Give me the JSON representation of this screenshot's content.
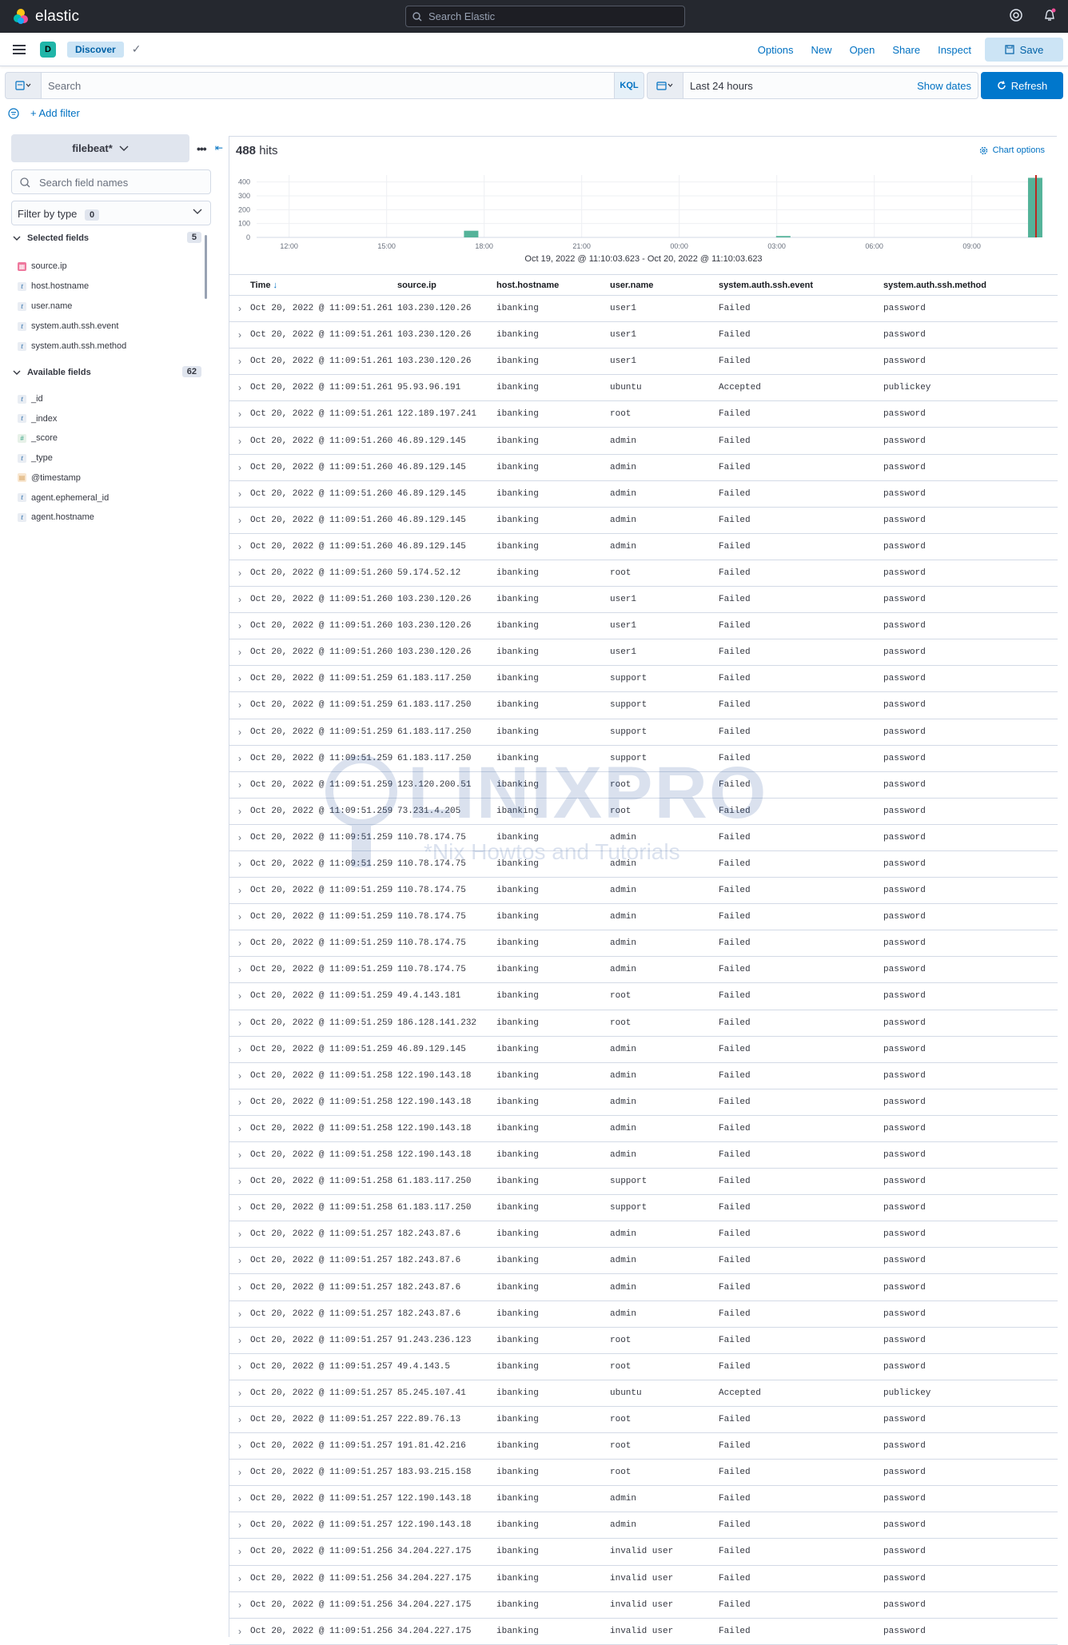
{
  "app": {
    "name": "elastic",
    "global_search_placeholder": "Search Elastic"
  },
  "nav": {
    "space_initial": "D",
    "breadcrumb": "Discover",
    "links": [
      "Options",
      "New",
      "Open",
      "Share",
      "Inspect"
    ],
    "save_label": "Save"
  },
  "query": {
    "search_placeholder": "Search",
    "language": "KQL",
    "time_range": "Last 24 hours",
    "show_dates": "Show dates",
    "refresh_label": "Refresh"
  },
  "filters": {
    "add_filter": "+ Add filter"
  },
  "sidebar": {
    "index_pattern": "filebeat*",
    "search_placeholder": "Search field names",
    "filter_by_type": "Filter by type",
    "filter_by_type_count": "0",
    "selected_title": "Selected fields",
    "selected_count": "5",
    "selected_fields": [
      {
        "name": "source.ip",
        "type": "ip"
      },
      {
        "name": "host.hostname",
        "type": "string"
      },
      {
        "name": "user.name",
        "type": "string"
      },
      {
        "name": "system.auth.ssh.event",
        "type": "string"
      },
      {
        "name": "system.auth.ssh.method",
        "type": "string"
      }
    ],
    "available_title": "Available fields",
    "available_count": "62",
    "available_fields": [
      {
        "name": "_id",
        "type": "string"
      },
      {
        "name": "_index",
        "type": "string"
      },
      {
        "name": "_score",
        "type": "number"
      },
      {
        "name": "_type",
        "type": "string"
      },
      {
        "name": "@timestamp",
        "type": "date"
      },
      {
        "name": "agent.ephemeral_id",
        "type": "string"
      },
      {
        "name": "agent.hostname",
        "type": "string"
      }
    ]
  },
  "main": {
    "hits_count": "488",
    "hits_label": "hits",
    "chart_options": "Chart options",
    "range_label": "Oct 19, 2022 @ 11:10:03.623 - Oct 20, 2022 @ 11:10:03.623"
  },
  "chart_data": {
    "type": "bar",
    "xlabel": "",
    "ylabel": "",
    "ylim": [
      0,
      450
    ],
    "yticks": [
      0,
      100,
      200,
      300,
      400
    ],
    "xticks": [
      "12:00",
      "15:00",
      "18:00",
      "21:00",
      "00:00",
      "03:00",
      "06:00",
      "09:00"
    ],
    "bar_color": "#54b399",
    "marker_color": "#bd271e",
    "grid": true,
    "values_note": "",
    "bars": [
      {
        "hour": 17.6,
        "value": 48
      },
      {
        "hour": 27.2,
        "value": 10
      },
      {
        "hour": 34.95,
        "value": 430
      }
    ]
  },
  "table": {
    "columns": [
      "Time",
      "source.ip",
      "host.hostname",
      "user.name",
      "system.auth.ssh.event",
      "system.auth.ssh.method"
    ],
    "rows": [
      [
        "Oct 20, 2022 @ 11:09:51.261",
        "103.230.120.26",
        "ibanking",
        "user1",
        "Failed",
        "password"
      ],
      [
        "Oct 20, 2022 @ 11:09:51.261",
        "103.230.120.26",
        "ibanking",
        "user1",
        "Failed",
        "password"
      ],
      [
        "Oct 20, 2022 @ 11:09:51.261",
        "103.230.120.26",
        "ibanking",
        "user1",
        "Failed",
        "password"
      ],
      [
        "Oct 20, 2022 @ 11:09:51.261",
        "95.93.96.191",
        "ibanking",
        "ubuntu",
        "Accepted",
        "publickey"
      ],
      [
        "Oct 20, 2022 @ 11:09:51.261",
        "122.189.197.241",
        "ibanking",
        "root",
        "Failed",
        "password"
      ],
      [
        "Oct 20, 2022 @ 11:09:51.260",
        "46.89.129.145",
        "ibanking",
        "admin",
        "Failed",
        "password"
      ],
      [
        "Oct 20, 2022 @ 11:09:51.260",
        "46.89.129.145",
        "ibanking",
        "admin",
        "Failed",
        "password"
      ],
      [
        "Oct 20, 2022 @ 11:09:51.260",
        "46.89.129.145",
        "ibanking",
        "admin",
        "Failed",
        "password"
      ],
      [
        "Oct 20, 2022 @ 11:09:51.260",
        "46.89.129.145",
        "ibanking",
        "admin",
        "Failed",
        "password"
      ],
      [
        "Oct 20, 2022 @ 11:09:51.260",
        "46.89.129.145",
        "ibanking",
        "admin",
        "Failed",
        "password"
      ],
      [
        "Oct 20, 2022 @ 11:09:51.260",
        "59.174.52.12",
        "ibanking",
        "root",
        "Failed",
        "password"
      ],
      [
        "Oct 20, 2022 @ 11:09:51.260",
        "103.230.120.26",
        "ibanking",
        "user1",
        "Failed",
        "password"
      ],
      [
        "Oct 20, 2022 @ 11:09:51.260",
        "103.230.120.26",
        "ibanking",
        "user1",
        "Failed",
        "password"
      ],
      [
        "Oct 20, 2022 @ 11:09:51.260",
        "103.230.120.26",
        "ibanking",
        "user1",
        "Failed",
        "password"
      ],
      [
        "Oct 20, 2022 @ 11:09:51.259",
        "61.183.117.250",
        "ibanking",
        "support",
        "Failed",
        "password"
      ],
      [
        "Oct 20, 2022 @ 11:09:51.259",
        "61.183.117.250",
        "ibanking",
        "support",
        "Failed",
        "password"
      ],
      [
        "Oct 20, 2022 @ 11:09:51.259",
        "61.183.117.250",
        "ibanking",
        "support",
        "Failed",
        "password"
      ],
      [
        "Oct 20, 2022 @ 11:09:51.259",
        "61.183.117.250",
        "ibanking",
        "support",
        "Failed",
        "password"
      ],
      [
        "Oct 20, 2022 @ 11:09:51.259",
        "123.120.200.51",
        "ibanking",
        "root",
        "Failed",
        "password"
      ],
      [
        "Oct 20, 2022 @ 11:09:51.259",
        "73.231.4.205",
        "ibanking",
        "root",
        "Failed",
        "password"
      ],
      [
        "Oct 20, 2022 @ 11:09:51.259",
        "110.78.174.75",
        "ibanking",
        "admin",
        "Failed",
        "password"
      ],
      [
        "Oct 20, 2022 @ 11:09:51.259",
        "110.78.174.75",
        "ibanking",
        "admin",
        "Failed",
        "password"
      ],
      [
        "Oct 20, 2022 @ 11:09:51.259",
        "110.78.174.75",
        "ibanking",
        "admin",
        "Failed",
        "password"
      ],
      [
        "Oct 20, 2022 @ 11:09:51.259",
        "110.78.174.75",
        "ibanking",
        "admin",
        "Failed",
        "password"
      ],
      [
        "Oct 20, 2022 @ 11:09:51.259",
        "110.78.174.75",
        "ibanking",
        "admin",
        "Failed",
        "password"
      ],
      [
        "Oct 20, 2022 @ 11:09:51.259",
        "110.78.174.75",
        "ibanking",
        "admin",
        "Failed",
        "password"
      ],
      [
        "Oct 20, 2022 @ 11:09:51.259",
        "49.4.143.181",
        "ibanking",
        "root",
        "Failed",
        "password"
      ],
      [
        "Oct 20, 2022 @ 11:09:51.259",
        "186.128.141.232",
        "ibanking",
        "root",
        "Failed",
        "password"
      ],
      [
        "Oct 20, 2022 @ 11:09:51.259",
        "46.89.129.145",
        "ibanking",
        "admin",
        "Failed",
        "password"
      ],
      [
        "Oct 20, 2022 @ 11:09:51.258",
        "122.190.143.18",
        "ibanking",
        "admin",
        "Failed",
        "password"
      ],
      [
        "Oct 20, 2022 @ 11:09:51.258",
        "122.190.143.18",
        "ibanking",
        "admin",
        "Failed",
        "password"
      ],
      [
        "Oct 20, 2022 @ 11:09:51.258",
        "122.190.143.18",
        "ibanking",
        "admin",
        "Failed",
        "password"
      ],
      [
        "Oct 20, 2022 @ 11:09:51.258",
        "122.190.143.18",
        "ibanking",
        "admin",
        "Failed",
        "password"
      ],
      [
        "Oct 20, 2022 @ 11:09:51.258",
        "61.183.117.250",
        "ibanking",
        "support",
        "Failed",
        "password"
      ],
      [
        "Oct 20, 2022 @ 11:09:51.258",
        "61.183.117.250",
        "ibanking",
        "support",
        "Failed",
        "password"
      ],
      [
        "Oct 20, 2022 @ 11:09:51.257",
        "182.243.87.6",
        "ibanking",
        "admin",
        "Failed",
        "password"
      ],
      [
        "Oct 20, 2022 @ 11:09:51.257",
        "182.243.87.6",
        "ibanking",
        "admin",
        "Failed",
        "password"
      ],
      [
        "Oct 20, 2022 @ 11:09:51.257",
        "182.243.87.6",
        "ibanking",
        "admin",
        "Failed",
        "password"
      ],
      [
        "Oct 20, 2022 @ 11:09:51.257",
        "182.243.87.6",
        "ibanking",
        "admin",
        "Failed",
        "password"
      ],
      [
        "Oct 20, 2022 @ 11:09:51.257",
        "91.243.236.123",
        "ibanking",
        "root",
        "Failed",
        "password"
      ],
      [
        "Oct 20, 2022 @ 11:09:51.257",
        "49.4.143.5",
        "ibanking",
        "root",
        "Failed",
        "password"
      ],
      [
        "Oct 20, 2022 @ 11:09:51.257",
        "85.245.107.41",
        "ibanking",
        "ubuntu",
        "Accepted",
        "publickey"
      ],
      [
        "Oct 20, 2022 @ 11:09:51.257",
        "222.89.76.13",
        "ibanking",
        "root",
        "Failed",
        "password"
      ],
      [
        "Oct 20, 2022 @ 11:09:51.257",
        "191.81.42.216",
        "ibanking",
        "root",
        "Failed",
        "password"
      ],
      [
        "Oct 20, 2022 @ 11:09:51.257",
        "183.93.215.158",
        "ibanking",
        "root",
        "Failed",
        "password"
      ],
      [
        "Oct 20, 2022 @ 11:09:51.257",
        "122.190.143.18",
        "ibanking",
        "admin",
        "Failed",
        "password"
      ],
      [
        "Oct 20, 2022 @ 11:09:51.257",
        "122.190.143.18",
        "ibanking",
        "admin",
        "Failed",
        "password"
      ],
      [
        "Oct 20, 2022 @ 11:09:51.256",
        "34.204.227.175",
        "ibanking",
        "invalid user",
        "Failed",
        "password"
      ],
      [
        "Oct 20, 2022 @ 11:09:51.256",
        "34.204.227.175",
        "ibanking",
        "invalid user",
        "Failed",
        "password"
      ],
      [
        "Oct 20, 2022 @ 11:09:51.256",
        "34.204.227.175",
        "ibanking",
        "invalid user",
        "Failed",
        "password"
      ],
      [
        "Oct 20, 2022 @ 11:09:51.256",
        "34.204.227.175",
        "ibanking",
        "invalid user",
        "Failed",
        "password"
      ]
    ]
  },
  "watermark": {
    "title": "LINIXPRO",
    "subtitle": "*Nix Howtos and Tutorials"
  },
  "colors": {
    "topbar": "#25282f",
    "accent": "#0077cc",
    "bar": "#54b399"
  }
}
